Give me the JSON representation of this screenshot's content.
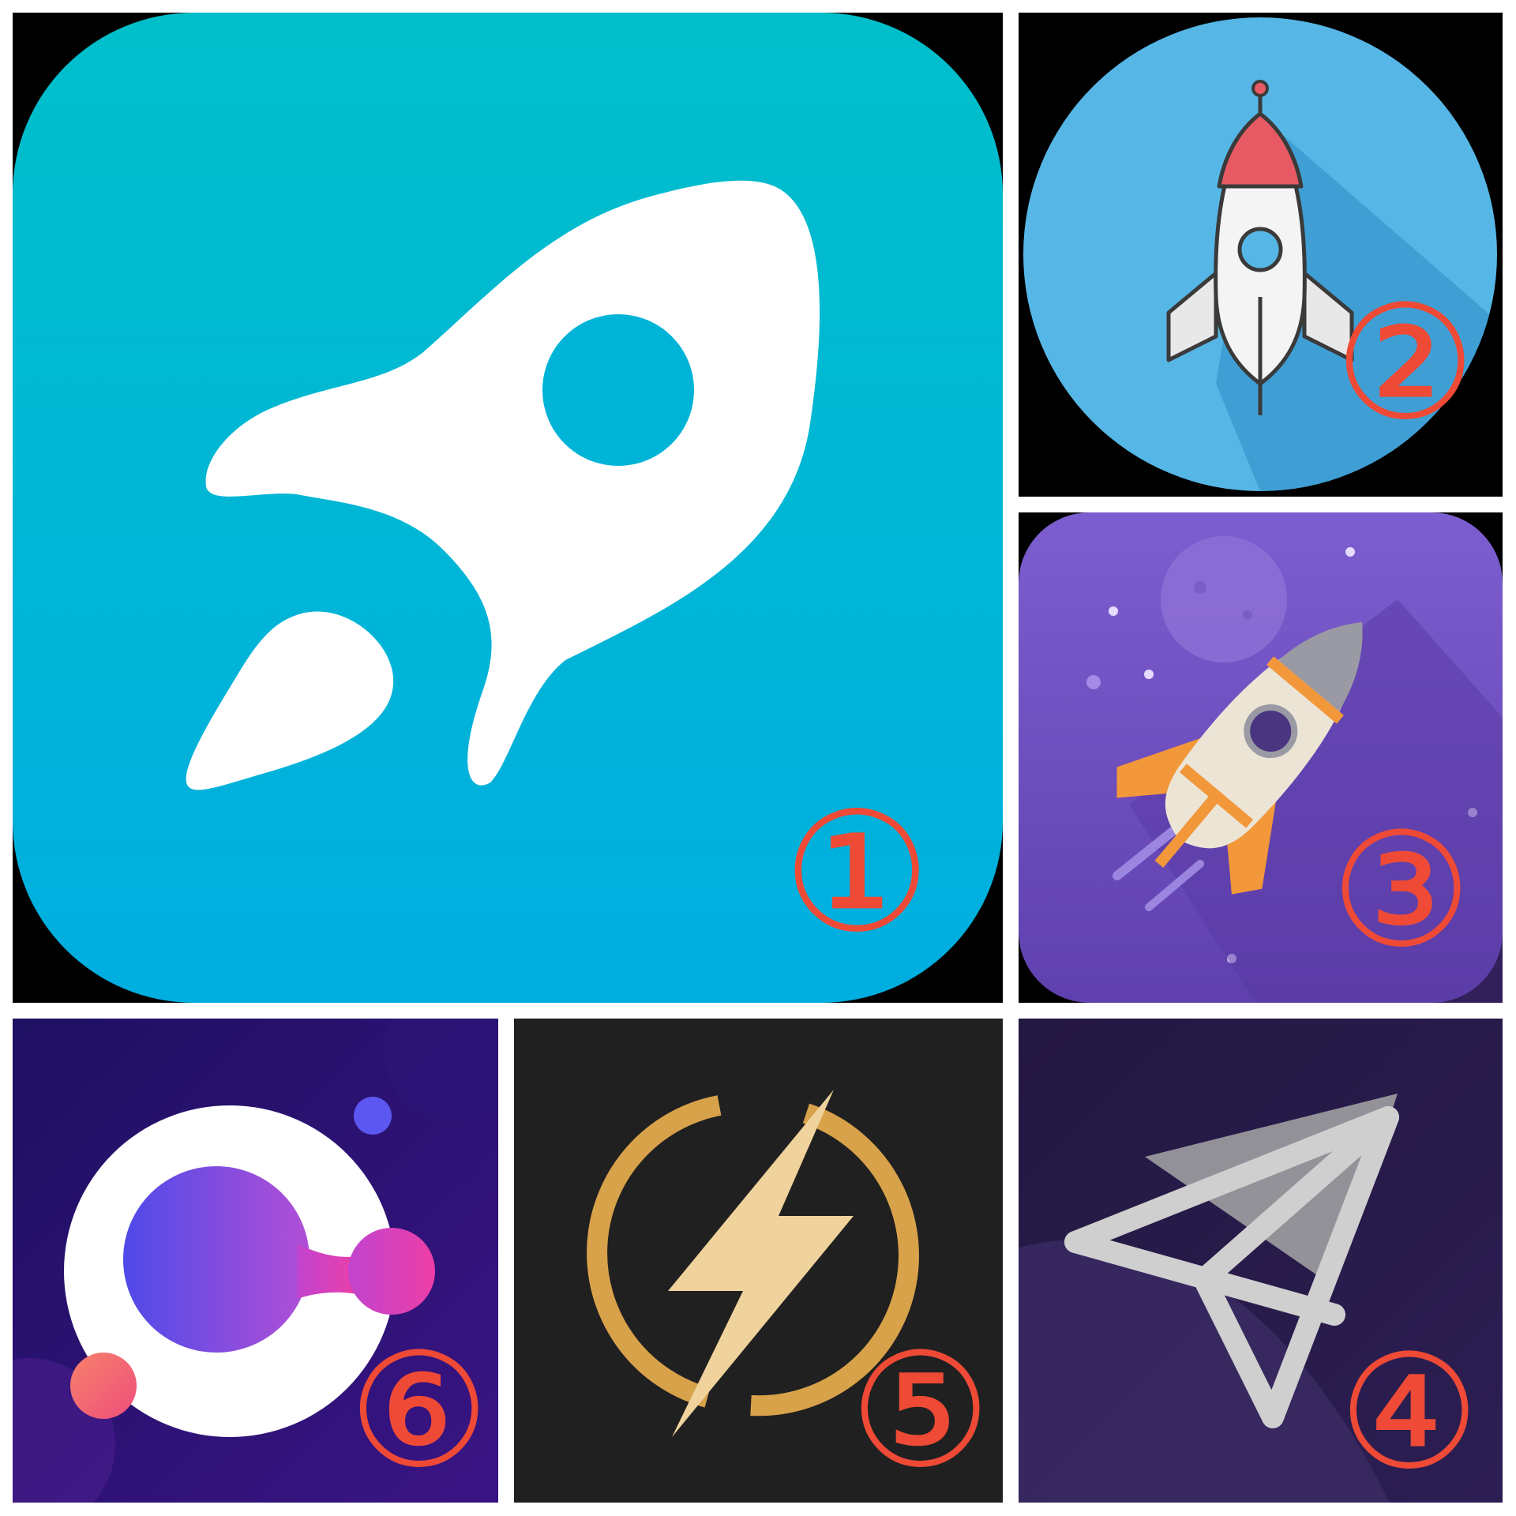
{
  "collage": {
    "tiles": [
      {
        "label": "①",
        "icon": "rocket-icon",
        "colors": {
          "background": "#00b6d5",
          "glyph": "#ffffff"
        }
      },
      {
        "label": "②",
        "icon": "rocket-icon",
        "colors": {
          "background": "#56b7e6",
          "shadow": "#3a98cf",
          "nose": "#e85a63"
        }
      },
      {
        "label": "③",
        "icon": "rocket-icon",
        "colors": {
          "background": "#7452c0",
          "fins": "#f2973a",
          "body": "#ece5d6"
        }
      },
      {
        "label": "④",
        "icon": "paper-plane-icon",
        "colors": {
          "background": "#271b45",
          "outline": "#c9c9c9"
        }
      },
      {
        "label": "⑤",
        "icon": "lightning-bolt-icon",
        "colors": {
          "background": "#202020",
          "ring": "#d8a24a",
          "bolt": "#f0d29c"
        }
      },
      {
        "label": "⑥",
        "icon": "orb-logo-icon",
        "colors": {
          "background": "#2a1270",
          "ring": "#ffffff",
          "core": "#8a4de0"
        }
      }
    ],
    "label_color": "#ee4a36"
  }
}
